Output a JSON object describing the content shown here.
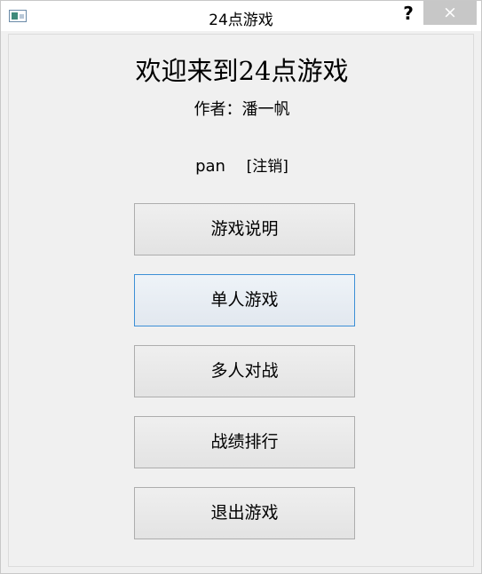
{
  "window": {
    "title": "24点游戏",
    "help_label": "?",
    "close_label": "×"
  },
  "welcome": {
    "heading": "欢迎来到24点游戏",
    "author": "作者：潘一帆"
  },
  "user": {
    "name": "pan",
    "logout_label": "[注销]"
  },
  "menu": {
    "rules": "游戏说明",
    "single": "单人游戏",
    "multi": "多人对战",
    "ranking": "战绩排行",
    "exit": "退出游戏"
  },
  "colors": {
    "focus_border": "#3c8fd6",
    "window_bg": "#f0f0f0",
    "close_bg": "#c7c7c7"
  }
}
